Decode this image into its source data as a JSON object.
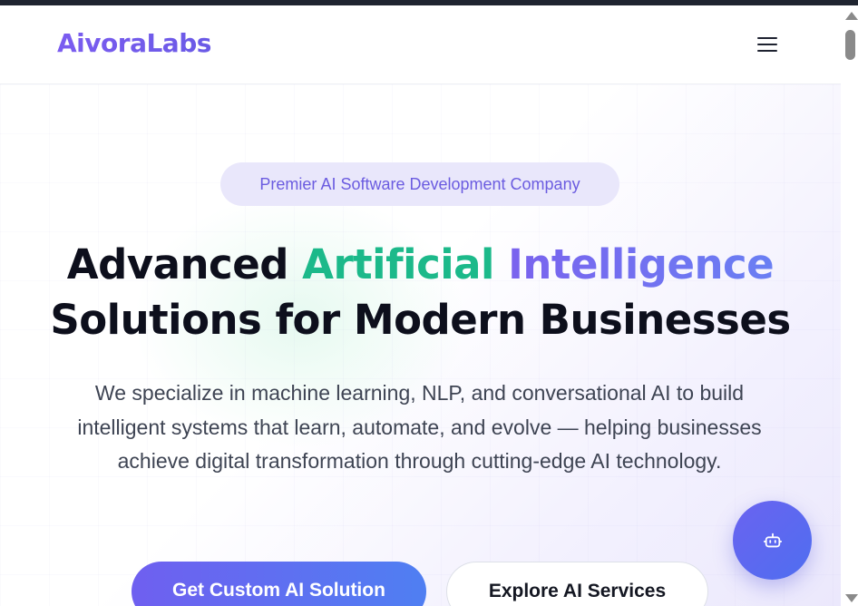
{
  "brand": {
    "name": "AivoraLabs"
  },
  "nav": {
    "menu_icon": "hamburger-menu-icon"
  },
  "hero": {
    "badge": "Premier AI Software Development Company",
    "headline": {
      "part1": "Advanced ",
      "part2": "Artificial",
      "part3": " ",
      "part4": "Intelligence",
      "part5": "Solutions for Modern Businesses"
    },
    "description": "We specialize in machine learning, NLP, and conversational AI to build intelligent systems that learn, automate, and evolve — helping businesses achieve digital transformation through cutting-edge AI technology.",
    "primary_cta": "Get Custom AI Solution",
    "secondary_cta": "Explore AI Services"
  },
  "chat_widget": {
    "icon": "robot-icon"
  },
  "colors": {
    "brand_purple": "#6b5ce0",
    "accent_green": "#1cb98a",
    "cta_gradient_start": "#6f5ff0",
    "cta_gradient_end": "#4f7ff2",
    "headline_text": "#0d0f1c"
  }
}
